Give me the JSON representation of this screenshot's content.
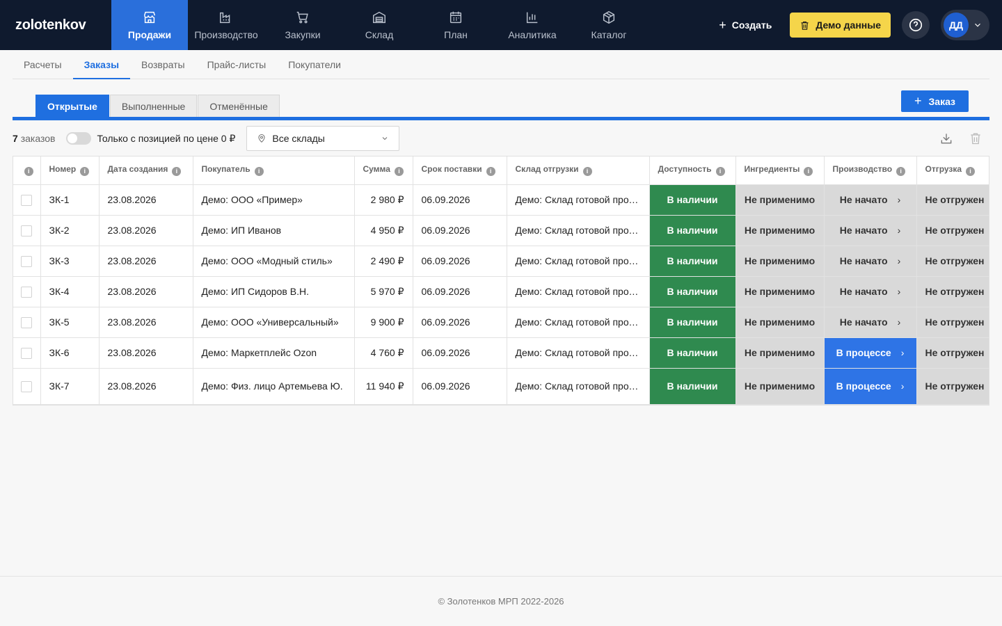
{
  "app": {
    "logo": "zolotenkov"
  },
  "nav": [
    {
      "label": "Продажи",
      "icon": "store-icon",
      "active": true
    },
    {
      "label": "Производство",
      "icon": "factory-icon"
    },
    {
      "label": "Закупки",
      "icon": "cart-icon"
    },
    {
      "label": "Склад",
      "icon": "warehouse-icon"
    },
    {
      "label": "План",
      "icon": "calendar-icon"
    },
    {
      "label": "Аналитика",
      "icon": "chart-icon"
    },
    {
      "label": "Каталог",
      "icon": "box-icon"
    }
  ],
  "top_actions": {
    "create_label": "Создать",
    "demo_label": "Демо данные",
    "avatar_initials": "ДД"
  },
  "subnav": [
    "Расчеты",
    "Заказы",
    "Возвраты",
    "Прайс-листы",
    "Покупатели"
  ],
  "subnav_active": "Заказы",
  "tabs": [
    "Открытые",
    "Выполненные",
    "Отменённые"
  ],
  "tab_active": "Открытые",
  "order_button": "Заказ",
  "filters": {
    "count_number": "7",
    "count_label": "заказов",
    "toggle_label": "Только с позицией по цене 0 ₽",
    "warehouse_select": "Все склады"
  },
  "table": {
    "columns": [
      "Номер",
      "Дата создания",
      "Покупатель",
      "Сумма",
      "Срок поставки",
      "Склад отгрузки",
      "Доступность",
      "Ингредиенты",
      "Производство",
      "Отгрузка"
    ],
    "rows": [
      {
        "number": "ЗК-1",
        "created": "23.08.2026",
        "customer": "Демо: ООО «Пример»",
        "sum": "2 980 ₽",
        "due": "06.09.2026",
        "warehouse": "Демо: Склад готовой продукции",
        "availability": "В наличии",
        "ingredients": "Не применимо",
        "production": "Не начато",
        "production_state": "gray",
        "shipment": "Не отгружен"
      },
      {
        "number": "ЗК-2",
        "created": "23.08.2026",
        "customer": "Демо: ИП Иванов",
        "sum": "4 950 ₽",
        "due": "06.09.2026",
        "warehouse": "Демо: Склад готовой продукции",
        "availability": "В наличии",
        "ingredients": "Не применимо",
        "production": "Не начато",
        "production_state": "gray",
        "shipment": "Не отгружен"
      },
      {
        "number": "ЗК-3",
        "created": "23.08.2026",
        "customer": "Демо: ООО «Модный стиль»",
        "sum": "2 490 ₽",
        "due": "06.09.2026",
        "warehouse": "Демо: Склад готовой продукции",
        "availability": "В наличии",
        "ingredients": "Не применимо",
        "production": "Не начато",
        "production_state": "gray",
        "shipment": "Не отгружен"
      },
      {
        "number": "ЗК-4",
        "created": "23.08.2026",
        "customer": "Демо: ИП Сидоров В.Н.",
        "sum": "5 970 ₽",
        "due": "06.09.2026",
        "warehouse": "Демо: Склад готовой продукции",
        "availability": "В наличии",
        "ingredients": "Не применимо",
        "production": "Не начато",
        "production_state": "gray",
        "shipment": "Не отгружен"
      },
      {
        "number": "ЗК-5",
        "created": "23.08.2026",
        "customer": "Демо: ООО «Универсальный»",
        "sum": "9 900 ₽",
        "due": "06.09.2026",
        "warehouse": "Демо: Склад готовой продукции",
        "availability": "В наличии",
        "ingredients": "Не применимо",
        "production": "Не начато",
        "production_state": "gray",
        "shipment": "Не отгружен"
      },
      {
        "number": "ЗК-6",
        "created": "23.08.2026",
        "customer": "Демо: Маркетплейс Ozon",
        "sum": "4 760 ₽",
        "due": "06.09.2026",
        "warehouse": "Демо: Склад готовой продукции",
        "availability": "В наличии",
        "ingredients": "Не применимо",
        "production": "В процессе",
        "production_state": "blue",
        "shipment": "Не отгружен"
      },
      {
        "number": "ЗК-7",
        "created": "23.08.2026",
        "customer": "Демо: Физ. лицо Артемьева Ю.",
        "sum": "11 940 ₽",
        "due": "06.09.2026",
        "warehouse": "Демо: Склад готовой продукции",
        "availability": "В наличии",
        "ingredients": "Не применимо",
        "production": "В процессе",
        "production_state": "blue",
        "shipment": "Не отгружен"
      }
    ]
  },
  "colors": {
    "nav_bg": "#0f1a2e",
    "accent": "#1f6fe0",
    "available": "#2f8a4f",
    "in_progress": "#2e74e6",
    "not_applicable": "#d9d9d9",
    "demo": "#f5d54a"
  },
  "footer": "© Золотенков МРП 2022-2026"
}
